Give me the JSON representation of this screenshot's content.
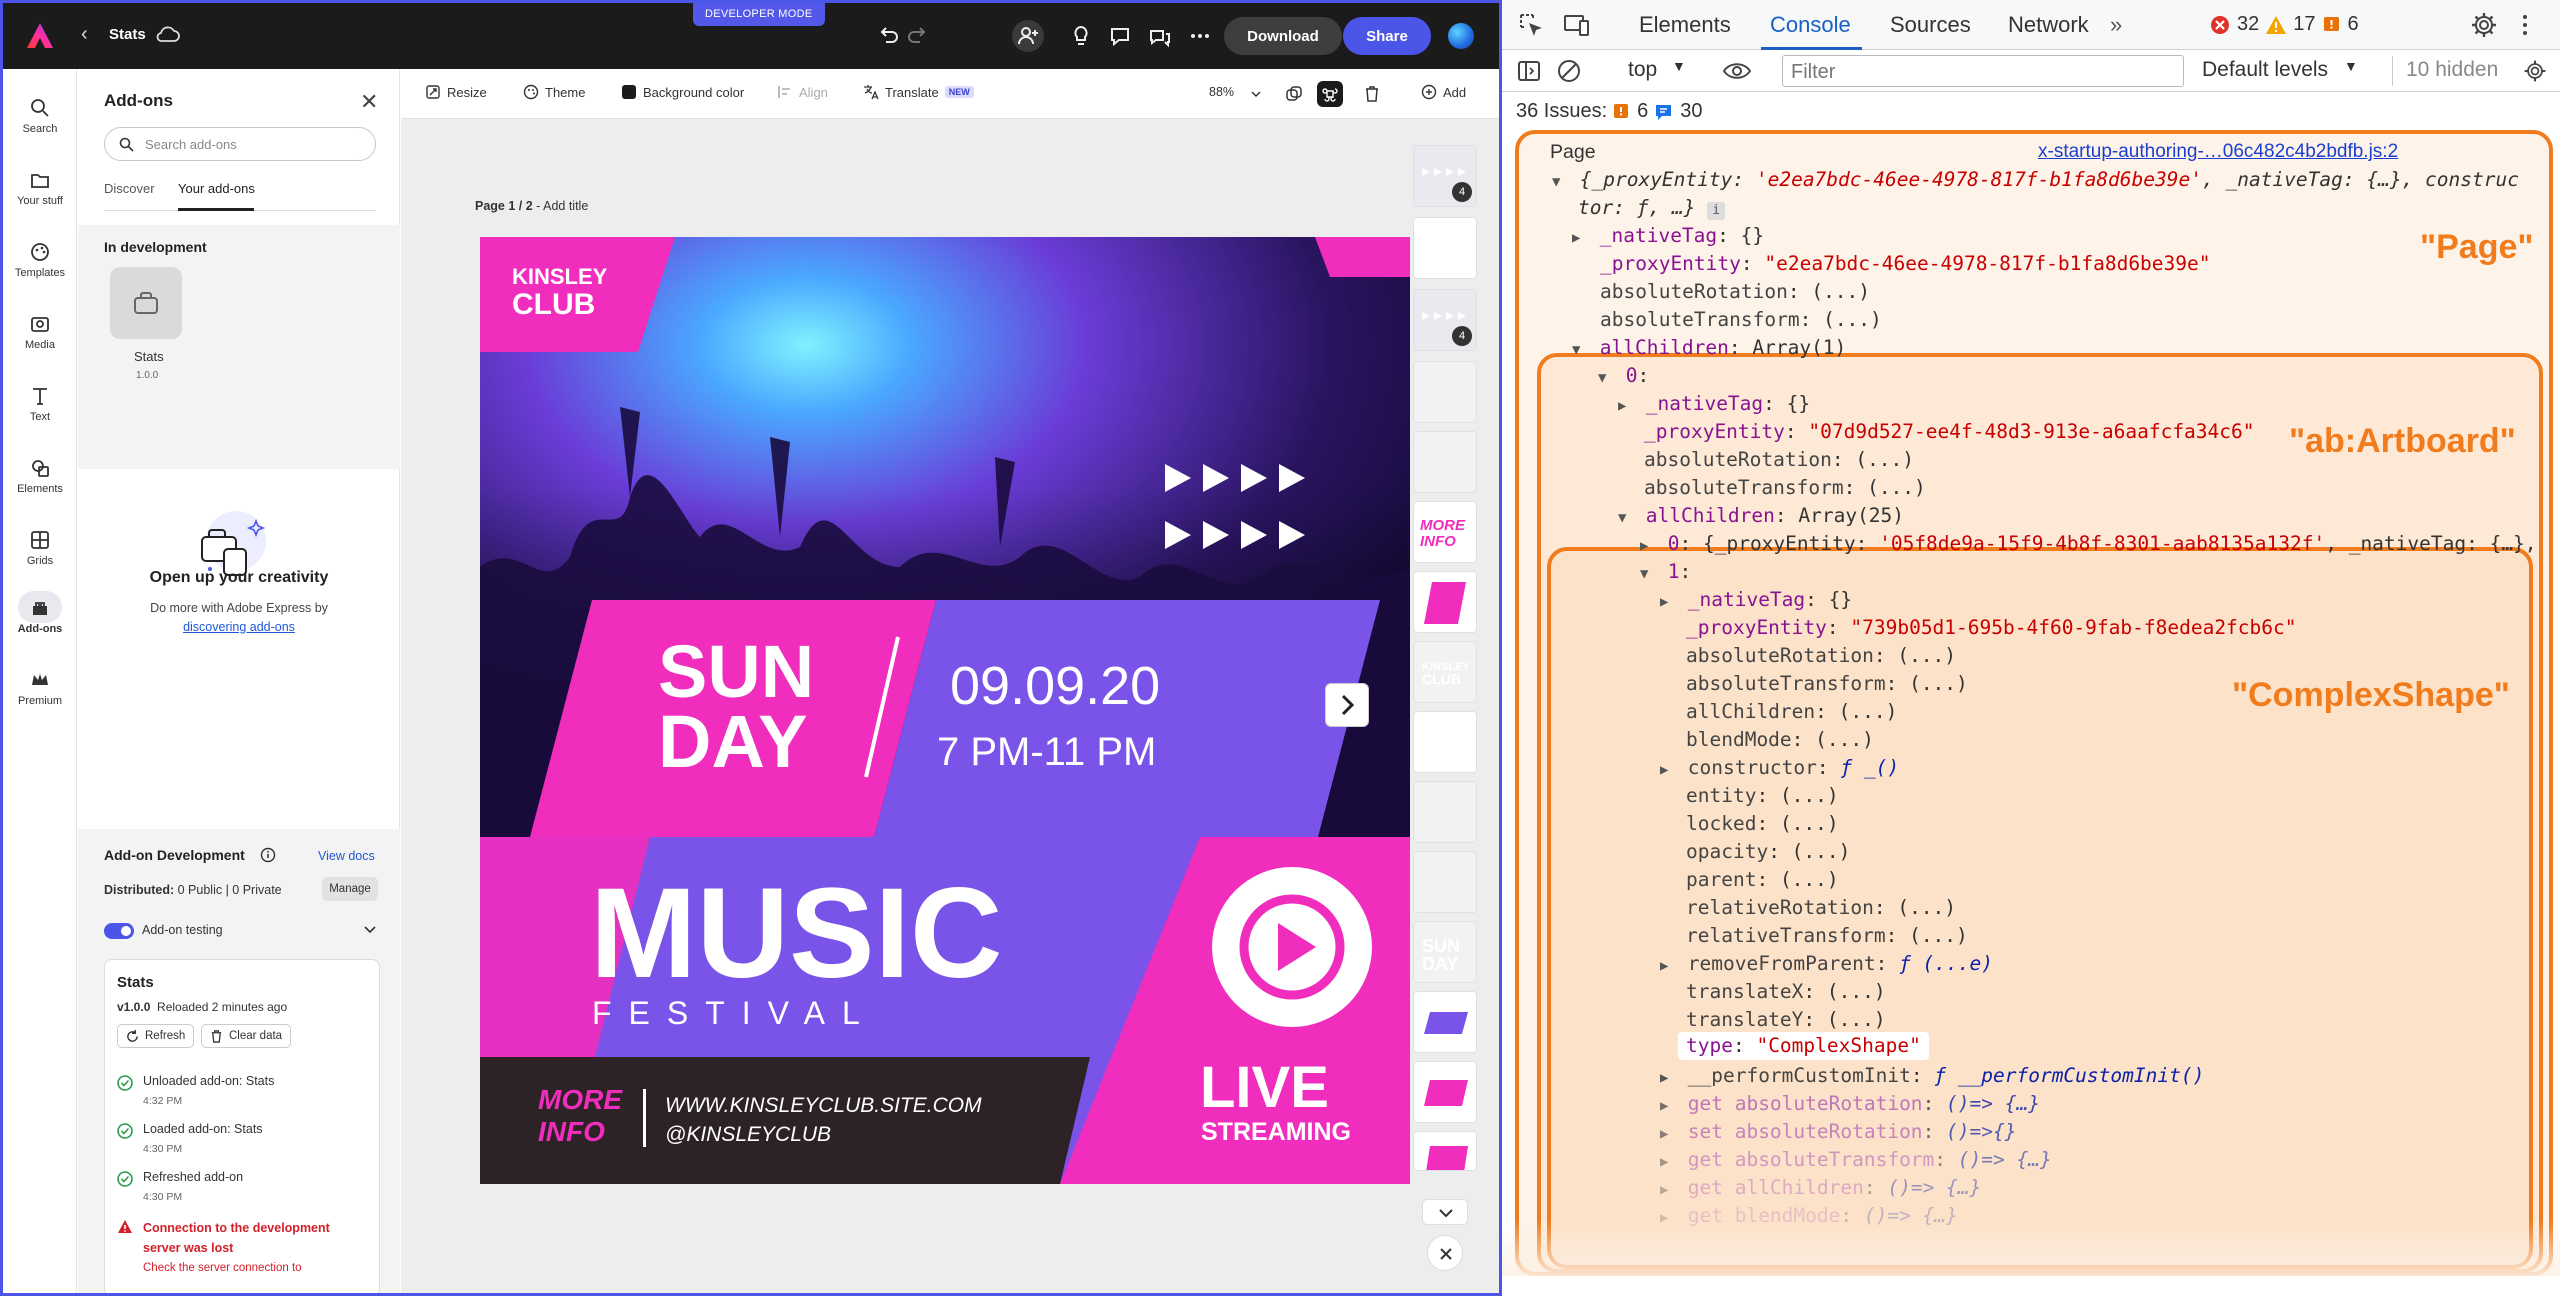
{
  "app": {
    "dev_mode_label": "DEVELOPER MODE",
    "doc_title": "Stats",
    "download_label": "Download",
    "share_label": "Share"
  },
  "rail": [
    {
      "label": "Search",
      "icon": "search-icon"
    },
    {
      "label": "Your stuff",
      "icon": "folder-icon"
    },
    {
      "label": "Templates",
      "icon": "templates-icon"
    },
    {
      "label": "Media",
      "icon": "media-icon"
    },
    {
      "label": "Text",
      "icon": "text-icon"
    },
    {
      "label": "Elements",
      "icon": "elements-icon"
    },
    {
      "label": "Grids",
      "icon": "grids-icon"
    },
    {
      "label": "Add-ons",
      "icon": "addons-icon",
      "active": true
    },
    {
      "label": "Premium",
      "icon": "crown-icon"
    }
  ],
  "addons": {
    "title": "Add-ons",
    "search_placeholder": "Search add-ons",
    "tabs": [
      "Discover",
      "Your add-ons"
    ],
    "in_dev_heading": "In development",
    "addon_name": "Stats",
    "addon_version": "1.0.0",
    "promo_title": "Open up your creativity",
    "promo_text": "Do more with Adobe Express by",
    "promo_link": "discovering add-ons",
    "dev_title": "Add-on Development",
    "view_docs": "View docs",
    "distributed_label": "Distributed:",
    "distributed_value": "0 Public | 0 Private",
    "manage": "Manage",
    "testing_label": "Add-on testing",
    "card_title": "Stats",
    "card_version": "v1.0.0",
    "card_reloaded": "Reloaded 2 minutes ago",
    "refresh": "Refresh",
    "clear_data": "Clear data",
    "logs": [
      {
        "text": "Unloaded add-on: Stats",
        "time": "4:32 PM"
      },
      {
        "text": "Loaded add-on: Stats",
        "time": "4:30 PM"
      },
      {
        "text": "Refreshed add-on",
        "time": "4:30 PM"
      }
    ],
    "error_text": "Connection to the development server was lost",
    "error_sub": "Check the server connection to"
  },
  "canvas": {
    "tools": [
      "Resize",
      "Theme",
      "Background color",
      "Align",
      "Translate"
    ],
    "new_badge": "NEW",
    "zoom": "88%",
    "add_label": "Add",
    "page_label_bold": "Page 1 / 2",
    "page_label_rest": " - Add title",
    "thumb_counts": [
      "4",
      "4"
    ]
  },
  "poster": {
    "brand1": "KINSLEY",
    "brand2": "CLUB",
    "day1": "SUN",
    "day2": "DAY",
    "date": "09.09.20",
    "time": "7 PM-11 PM",
    "music": "MUSIC",
    "festival": "FESTIVAL",
    "more": "MORE",
    "info": "INFO",
    "site": "WWW.KINSLEYCLUB.SITE.COM",
    "handle": "@KINSLEYCLUB",
    "live": "LIVE",
    "streaming": "STREAMING"
  },
  "devtools": {
    "tabs": [
      "Elements",
      "Console",
      "Sources",
      "Network"
    ],
    "errors": "32",
    "warnings": "17",
    "info": "6",
    "context": "top",
    "filter_placeholder": "Filter",
    "levels": "Default levels",
    "hidden": "10 hidden",
    "issues_label": "36 Issues:",
    "issues_warn": "6",
    "issues_info": "30",
    "source_link": "x-startup-authoring-…06c482c4b2bdfb.js:2",
    "label_page": "\"Page\"",
    "label_artboard": "\"ab:Artboard\"",
    "label_complex": "\"ComplexShape\"",
    "lines": {
      "page": "Page",
      "page_summary_a": "{_proxyEntity: ",
      "page_summary_b": "'e2ea7bdc-46ee-4978-817f-b1fa8d6be39e'",
      "page_summary_c": ", _nativeTag: {…}, construc",
      "page_summary_d": "tor: ƒ, …}",
      "native_tag": "_nativeTag",
      "empty_obj": ": {}",
      "proxy_entity": "_proxyEntity",
      "page_proxy": "\"e2ea7bdc-46ee-4978-817f-b1fa8d6be39e\"",
      "abs_rot": "absoluteRotation",
      "abs_tf": "absoluteTransform",
      "all_children": "allChildren",
      "array1": ": Array(1)",
      "idx0": "0",
      "ab_proxy": "\"07d9d527-ee4f-48d3-913e-a6aafcfa34c6\"",
      "array25": ": Array(25)",
      "child0_a": "{_proxyEntity: ",
      "child0_b": "'05f8de9a-15f9-4b8f-8301-aab8135a132f'",
      "child0_c": ", _nativeTag: {…},",
      "idx1": "1",
      "cs_proxy": "\"739b05d1-695b-4f60-9fab-f8edea2fcb6c\"",
      "blend": "blendMode",
      "constructor": "constructor",
      "constructor_val": "ƒ _()",
      "entity": "entity",
      "locked": "locked",
      "opacity": "opacity",
      "parent": "parent",
      "rel_rot": "relativeRotation",
      "rel_tf": "relativeTransform",
      "remove": "removeFromParent",
      "remove_val": "ƒ (...e)",
      "tx": "translateX",
      "ty": "translateY",
      "type": "type",
      "type_val": "\"ComplexShape\"",
      "perform": "__performCustomInit",
      "perform_val": "ƒ __performCustomInit()",
      "get_abs_rot": "get absoluteRotation",
      "get_abs_rot_val": "()=> {…}",
      "set_abs_rot": "set absoluteRotation",
      "set_abs_rot_val": "()=>{}",
      "get_abs_tf": "get absoluteTransform",
      "get_abs_tf_val": "()=> {…}",
      "get_all": "get allChildren",
      "get_all_val": "()=> {…}",
      "get_blend": "get blendMode",
      "get_blend_val": "()=> {…}",
      "lazy": "(...)",
      "colon": ": "
    }
  },
  "colors": {
    "accent": "#4b55e8",
    "magenta": "#f02dbd",
    "purple": "#7a53e8",
    "orange_annotation": "#f07c1d"
  }
}
